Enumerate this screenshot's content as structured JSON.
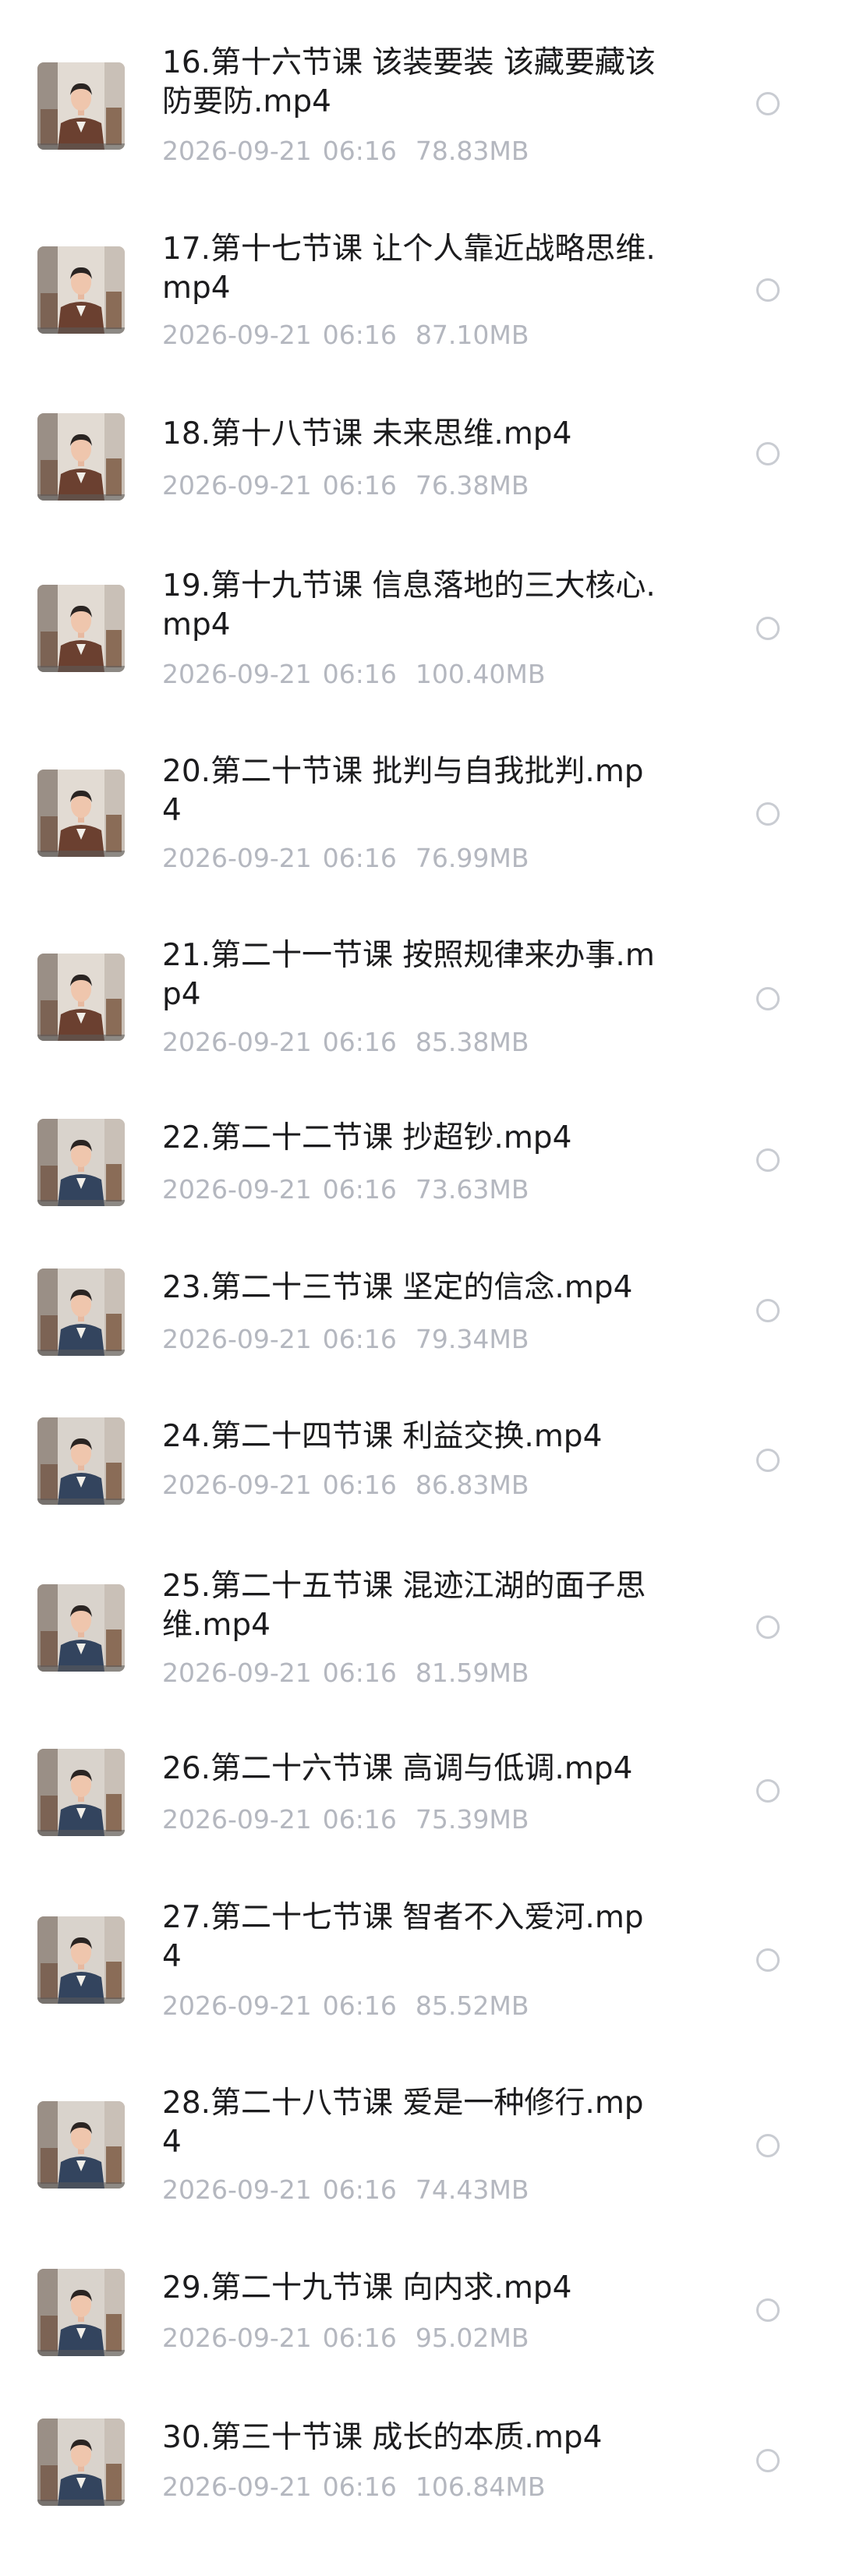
{
  "files": [
    {
      "name": "16.第十六节课 该装要装 该藏要藏该防要防.mp4",
      "date": "2026-09-21",
      "time": "06:16",
      "size": "78.83MB",
      "scene": "brown"
    },
    {
      "name": "17.第十七节课 让个人靠近战略思维.mp4",
      "date": "2026-09-21",
      "time": "06:16",
      "size": "87.10MB",
      "scene": "brown"
    },
    {
      "name": "18.第十八节课 未来思维.mp4",
      "date": "2026-09-21",
      "time": "06:16",
      "size": "76.38MB",
      "scene": "brown"
    },
    {
      "name": "19.第十九节课 信息落地的三大核心.mp4",
      "date": "2026-09-21",
      "time": "06:16",
      "size": "100.40MB",
      "scene": "brown"
    },
    {
      "name": "20.第二十节课 批判与自我批判.mp4",
      "date": "2026-09-21",
      "time": "06:16",
      "size": "76.99MB",
      "scene": "brown"
    },
    {
      "name": "21.第二十一节课 按照规律来办事.mp4",
      "date": "2026-09-21",
      "time": "06:16",
      "size": "85.38MB",
      "scene": "brown"
    },
    {
      "name": "22.第二十二节课 抄超钞.mp4",
      "date": "2026-09-21",
      "time": "06:16",
      "size": "73.63MB",
      "scene": "blue"
    },
    {
      "name": "23.第二十三节课 坚定的信念.mp4",
      "date": "2026-09-21",
      "time": "06:16",
      "size": "79.34MB",
      "scene": "blue"
    },
    {
      "name": "24.第二十四节课 利益交换.mp4",
      "date": "2026-09-21",
      "time": "06:16",
      "size": "86.83MB",
      "scene": "blue"
    },
    {
      "name": "25.第二十五节课 混迹江湖的面子思维.mp4",
      "date": "2026-09-21",
      "time": "06:16",
      "size": "81.59MB",
      "scene": "blue"
    },
    {
      "name": "26.第二十六节课 高调与低调.mp4",
      "date": "2026-09-21",
      "time": "06:16",
      "size": "75.39MB",
      "scene": "blue"
    },
    {
      "name": "27.第二十七节课 智者不入爱河.mp4",
      "date": "2026-09-21",
      "time": "06:16",
      "size": "85.52MB",
      "scene": "blue"
    },
    {
      "name": "28.第二十八节课 爱是一种修行.mp4",
      "date": "2026-09-21",
      "time": "06:16",
      "size": "74.43MB",
      "scene": "blue"
    },
    {
      "name": "29.第二十九节课 向内求.mp4",
      "date": "2026-09-21",
      "time": "06:16",
      "size": "95.02MB",
      "scene": "blue"
    },
    {
      "name": "30.第三十节课 成长的本质.mp4",
      "date": "2026-09-21",
      "time": "06:16",
      "size": "106.84MB",
      "scene": "blue"
    }
  ],
  "colors": {
    "title": "#1c1c1e",
    "meta": "#b4b7bf",
    "radio_border": "#c9ccd2",
    "jacket_brown": "#6b4030",
    "jacket_blue": "#33445e"
  },
  "icons": {
    "thumbnail": "video-thumbnail-icon",
    "select": "radio-button-icon"
  }
}
